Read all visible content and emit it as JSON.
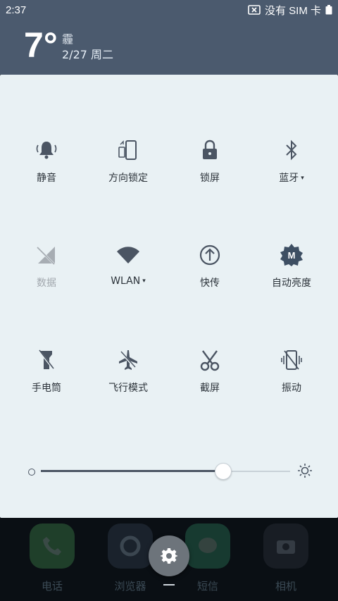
{
  "status_bar": {
    "time": "2:37",
    "sim_text": "没有 SIM 卡"
  },
  "weather": {
    "temperature": "7°",
    "condition": "霾",
    "date": "2/27 周二"
  },
  "tiles": [
    {
      "label": "静音",
      "icon": "bell-icon",
      "caret": false,
      "dim": false
    },
    {
      "label": "方向锁定",
      "icon": "rotation-lock-icon",
      "caret": false,
      "dim": false
    },
    {
      "label": "锁屏",
      "icon": "lock-icon",
      "caret": false,
      "dim": false
    },
    {
      "label": "蓝牙",
      "icon": "bluetooth-icon",
      "caret": true,
      "dim": false
    },
    {
      "label": "数据",
      "icon": "mobile-data-icon",
      "caret": false,
      "dim": true
    },
    {
      "label": "WLAN",
      "icon": "wifi-icon",
      "caret": true,
      "dim": false
    },
    {
      "label": "快传",
      "icon": "quick-transfer-icon",
      "caret": false,
      "dim": false
    },
    {
      "label": "自动亮度",
      "icon": "auto-brightness-icon",
      "caret": false,
      "dim": false
    },
    {
      "label": "手电筒",
      "icon": "flashlight-icon",
      "caret": false,
      "dim": false
    },
    {
      "label": "飞行模式",
      "icon": "airplane-icon",
      "caret": false,
      "dim": false
    },
    {
      "label": "截屏",
      "icon": "scissors-icon",
      "caret": false,
      "dim": false
    },
    {
      "label": "振动",
      "icon": "vibrate-icon",
      "caret": false,
      "dim": false
    }
  ],
  "brightness": {
    "level": 0.73
  },
  "dock": [
    {
      "name": "电话",
      "icon": "phone-icon",
      "color": "#1f5a2e"
    },
    {
      "name": "浏览器",
      "icon": "browser-icon",
      "color": "#202a36"
    },
    {
      "name": "短信",
      "icon": "message-icon",
      "color": "#1d4a3a"
    },
    {
      "name": "相机",
      "icon": "camera-icon",
      "color": "#20252c"
    }
  ],
  "caret_symbol": "▾",
  "colors": {
    "header": "#4b5a6e",
    "panel": "#e9f1f4",
    "icon": "#4b5563"
  }
}
